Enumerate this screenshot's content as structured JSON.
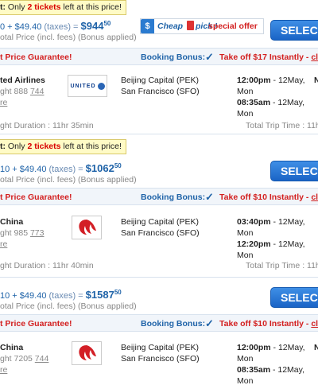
{
  "results": [
    {
      "alert": {
        "prefix": "t:",
        "text_before": " Only ",
        "count": "2 tickets",
        "text_after": " left at this price!"
      },
      "price": {
        "base": "0",
        "plus": " + ",
        "taxes": "$49.40",
        "taxes_label": " (taxes) = ",
        "total": "$944",
        "cents": "50"
      },
      "price_sub": "otal Price (incl. fees) (Bonus applied)",
      "promo": {
        "shield": "$",
        "brand": "Cheap",
        "bang": "pick !",
        "offer": "special offer"
      },
      "select_label": "SELEC",
      "guarantee": "t Price Guarantee!",
      "bonus_label": "Booking Bonus:",
      "bonus_check": "✓",
      "bonus_offer": "Take off $17 Instantly - ",
      "bonus_link": "clic",
      "airline": "ted Airlines",
      "flight_prefix": "ght 888 ",
      "flight_num": "744",
      "more": "re",
      "logo": "united-logo",
      "logo_text": "UNITED",
      "from": "Beijing Capital (PEK)",
      "to": "San Francisco (SFO)",
      "dep_time": "12:00pm",
      "dep_date": " - 12May,",
      "dep_day": "Mon",
      "arr_time": "08:35am",
      "arr_date": " - 12May,",
      "arr_day": "Mon",
      "edge_char": "N",
      "duration": "ght Duration : 11hr 35min",
      "total_trip": "Total Trip Time : 11h"
    },
    {
      "alert": {
        "prefix": "t:",
        "text_before": " Only ",
        "count": "2 tickets",
        "text_after": " left at this price!"
      },
      "price": {
        "base": "10",
        "plus": " + ",
        "taxes": "$49.40",
        "taxes_label": " (taxes) = ",
        "total": "$1062",
        "cents": "50"
      },
      "price_sub": "otal Price (incl. fees) (Bonus applied)",
      "select_label": "SELEC",
      "guarantee": "t Price Guarantee!",
      "bonus_label": "Booking Bonus:",
      "bonus_check": "✓",
      "bonus_offer": "Take off $10 Instantly - ",
      "bonus_link": "clic",
      "airline": "China",
      "flight_prefix": "ght 985 ",
      "flight_num": "773",
      "more": "re",
      "logo": "air-china-logo",
      "from": "Beijing Capital (PEK)",
      "to": "San Francisco (SFO)",
      "dep_time": "03:40pm",
      "dep_date": " - 12May,",
      "dep_day": "Mon",
      "arr_time": "12:20pm",
      "arr_date": " - 12May,",
      "arr_day": "Mon",
      "edge_char": "",
      "duration": "ght Duration : 11hr 40min",
      "total_trip": "Total Trip Time : 11h"
    },
    {
      "price": {
        "base": "10",
        "plus": " + ",
        "taxes": "$49.40",
        "taxes_label": " (taxes) = ",
        "total": "$1587",
        "cents": "50"
      },
      "price_sub": "otal Price (incl. fees) (Bonus applied)",
      "select_label": "SELEC",
      "guarantee": "t Price Guarantee!",
      "bonus_label": "Booking Bonus:",
      "bonus_check": "✓",
      "bonus_offer": "Take off $10 Instantly - ",
      "bonus_link": "clic",
      "airline": "China",
      "flight_prefix": "ght 7205 ",
      "flight_num": "744",
      "more": "re",
      "logo": "air-china-logo",
      "from": "Beijing Capital (PEK)",
      "to": "San Francisco (SFO)",
      "dep_time": "12:00pm",
      "dep_date": " - 12May,",
      "dep_day": "Mon",
      "arr_time": "08:35am",
      "arr_date": " - 12May,",
      "arr_day": "Mon",
      "edge_char": "N"
    }
  ],
  "colors": {
    "accent": "#1f63a8",
    "alert_bg": "#fffbc6",
    "offer_red": "#d32020",
    "button_blue": "#1a64c6"
  }
}
